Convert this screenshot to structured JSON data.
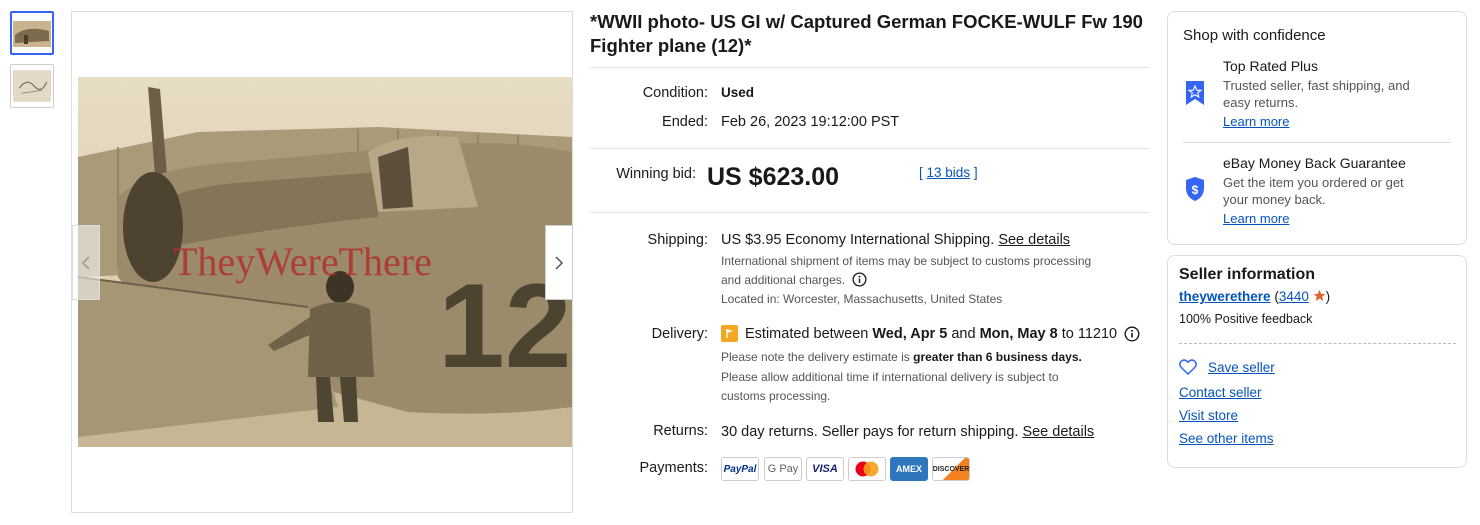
{
  "thumbnails": [
    {
      "name": "thumbnail-1",
      "active": true
    },
    {
      "name": "thumbnail-2",
      "active": false
    }
  ],
  "photo": {
    "watermark": "TheyWereThere",
    "number": "12"
  },
  "title": "*WWII photo- US GI w/ Captured German FOCKE-WULF Fw 190 Fighter plane (12)*",
  "details": {
    "condition_label": "Condition:",
    "condition_value": "Used",
    "ended_label": "Ended:",
    "ended_value": "Feb 26, 2023 19:12:00 PST"
  },
  "bid": {
    "label": "Winning bid:",
    "amount": "US $623.00",
    "bids_open": "[",
    "bids_link": "13 bids",
    "bids_close": "]"
  },
  "shipping": {
    "label": "Shipping:",
    "price": "US $3.95",
    "method": "Economy International Shipping.",
    "details_link": "See details",
    "note_line1": "International shipment of items may be subject to customs processing",
    "note_line2": "and additional charges.",
    "location": "Located in: Worcester, Massachusetts, United States"
  },
  "delivery": {
    "label": "Delivery:",
    "prefix": "Estimated between",
    "date1": "Wed, Apr 5",
    "and": "and",
    "date2": "Mon, May 8",
    "suffix": "to 11210",
    "note1_pre": "Please note the delivery estimate is",
    "note1_bold": "greater than 6 business days.",
    "note2_line1": "Please allow additional time if international delivery is subject to",
    "note2_line2": "customs processing."
  },
  "returns": {
    "label": "Returns:",
    "text": "30 day returns. Seller pays for return shipping.",
    "details_link": "See details"
  },
  "payments": {
    "label": "Payments:",
    "methods": [
      "PayPal",
      "G Pay",
      "VISA",
      "Mastercard",
      "AMEX",
      "DISCOVER"
    ]
  },
  "confidence": {
    "heading": "Shop with confidence",
    "top_rated_title": "Top Rated Plus",
    "top_rated_line1": "Trusted seller, fast shipping, and",
    "top_rated_line2": "easy returns.",
    "top_rated_link": "Learn more",
    "mbg_title": "eBay Money Back Guarantee",
    "mbg_line1": "Get the item you ordered or get",
    "mbg_line2": "your money back.",
    "mbg_link": "Learn more"
  },
  "seller": {
    "heading": "Seller information",
    "name": "theywerethere",
    "score_open": "(",
    "score": "3440",
    "score_close": ")",
    "feedback": "100% Positive feedback",
    "save_seller": "Save seller",
    "contact": "Contact seller",
    "visit_store": "Visit store",
    "other_items": "See other items"
  },
  "colors": {
    "link": "#0654ba",
    "accent": "#3665f3",
    "star": "#e0622d",
    "flag": "#f5a623"
  }
}
